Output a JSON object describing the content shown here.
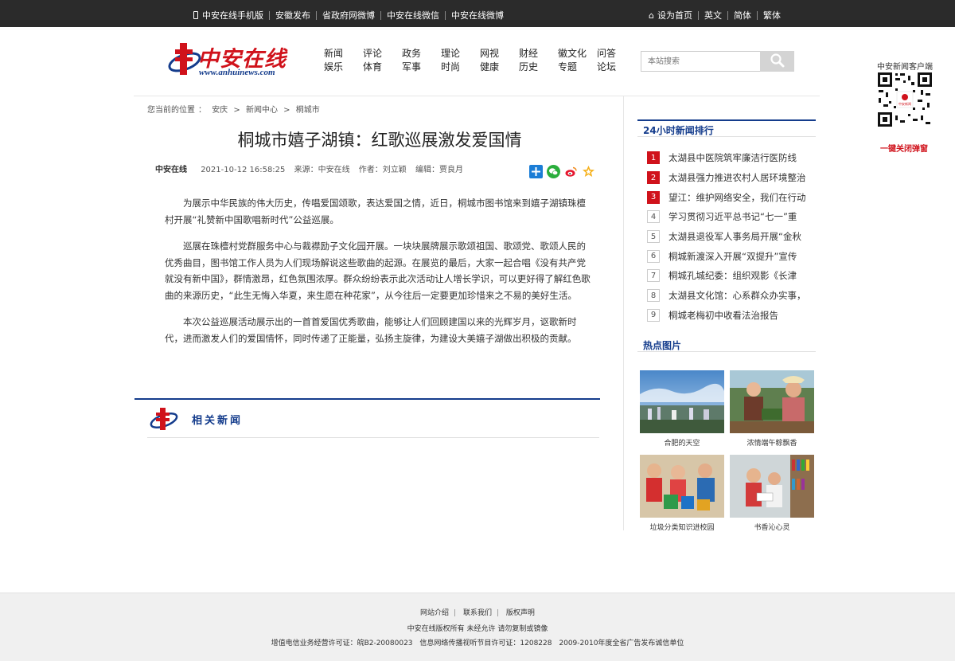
{
  "topbar": {
    "links": [
      "中安在线手机版",
      "安徽发布",
      "省政府网微博",
      "中安在线微信",
      "中安在线微博"
    ],
    "right": [
      "设为首页",
      "英文",
      "简体",
      "繁体"
    ]
  },
  "logo": {
    "cn": "中安在线",
    "en": "www.anhuinews.com"
  },
  "nav": {
    "row1": [
      "新闻",
      "评论",
      "政务",
      "理论",
      "网视",
      "财经",
      "徽文化",
      "问答"
    ],
    "row2": [
      "娱乐",
      "体育",
      "军事",
      "时尚",
      "健康",
      "历史",
      "专题",
      "论坛"
    ]
  },
  "search": {
    "placeholder": "本站搜索"
  },
  "qr": {
    "label": "中安新闻客户端",
    "close": "一键关闭弹窗",
    "badge": "中安新闻"
  },
  "breadcrumb": [
    "您当前的位置",
    "：",
    "安庆",
    ">",
    "新闻中心",
    ">",
    "桐城市"
  ],
  "article": {
    "title": "桐城市嬉子湖镇：红歌巡展激发爱国情",
    "source_site": "中安在线",
    "time": "2021-10-12 16:58:25",
    "source": "来源：中安在线",
    "author": "作者：刘立颖",
    "editor": "编辑：贾良月",
    "paragraphs": [
      "为展示中华民族的伟大历史，传唱爱国颂歌，表达爱国之情，近日，桐城市图书馆来到嬉子湖镇珠檀村开展“礼赞新中国歌唱新时代”公益巡展。",
      "巡展在珠檀村党群服务中心与裁襟励子文化园开展。一块块展牌展示歌颂祖国、歌颂党、歌颂人民的优秀曲目，图书馆工作人员为人们现场解说这些歌曲的起源。在展览的最后，大家一起合唱《没有共产党就没有新中国》，群情激昂，红色氛围浓厚。群众纷纷表示此次活动让人增长学识，可以更好得了解红色歌曲的来源历史，“此生无悔入华夏，来生愿在种花家”，从今往后一定要更加珍惜来之不易的美好生活。",
      "本次公益巡展活动展示出的一首首爱国优秀歌曲，能够让人们回顾建国以来的光辉岁月，讴歌新时代，进而激发人们的爱国情怀，同时传递了正能量，弘扬主旋律，为建设大美嬉子湖做出积极的贡献。"
    ]
  },
  "related": {
    "label": "相关新闻"
  },
  "sidebar": {
    "rank_title": "24小时新闻排行",
    "rank": [
      {
        "num": "1",
        "text": "太湖县中医院筑牢廉洁行医防线"
      },
      {
        "num": "2",
        "text": "太湖县强力推进农村人居环境整治"
      },
      {
        "num": "3",
        "text": "望江：维护网络安全，我们在行动"
      },
      {
        "num": "4",
        "text": "学习贯彻习近平总书记“七一”重"
      },
      {
        "num": "5",
        "text": "太湖县退役军人事务局开展“金秋"
      },
      {
        "num": "6",
        "text": "桐城新渡深入开展“双提升”宣传"
      },
      {
        "num": "7",
        "text": "桐城孔城纪委：组织观影《长津"
      },
      {
        "num": "8",
        "text": "太湖县文化馆：心系群众办实事，"
      },
      {
        "num": "9",
        "text": "桐城老梅初中收看法治报告"
      }
    ],
    "pics_title": "热点图片",
    "pics": [
      {
        "caption": "合肥的天空"
      },
      {
        "caption": "浓情端午粽飘香"
      },
      {
        "caption": "垃圾分类知识进校园"
      },
      {
        "caption": "书香沁心灵"
      }
    ]
  },
  "footer": {
    "links": [
      "网站介绍",
      "联系我们",
      "版权声明"
    ],
    "copyright": "中安在线版权所有 未经允许 请勿复制或镜像",
    "license": [
      "增值电信业务经营许可证：皖B2-20080023",
      "信息网络传播视听节目许可证：1208228",
      "2009-2010年度全省广告发布诚信单位"
    ]
  }
}
